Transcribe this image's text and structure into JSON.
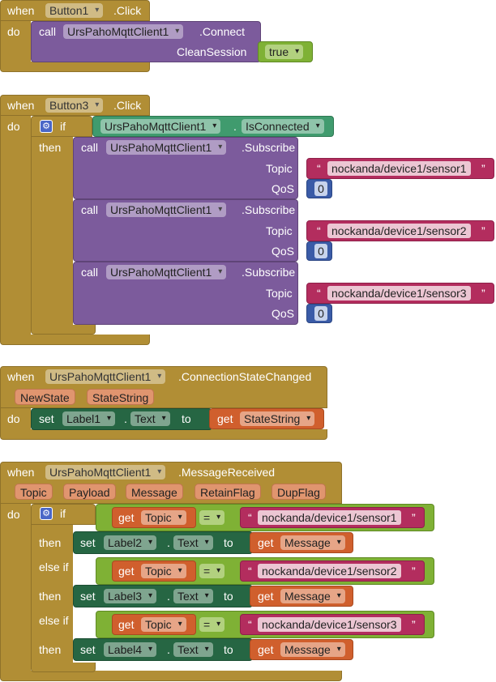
{
  "blocks": {
    "b1": {
      "when": "when",
      "component": "Button1",
      "event": ".Click",
      "do": "do",
      "call": "call",
      "target": "UrsPahoMqttClient1",
      "method": ".Connect",
      "arg_label": "CleanSession",
      "arg_value": "true"
    },
    "b2": {
      "when": "when",
      "component": "Button3",
      "event": ".Click",
      "do": "do",
      "if": "if",
      "then": "then",
      "cond_component": "UrsPahoMqttClient1",
      "cond_property": "IsConnected",
      "calls": [
        {
          "call": "call",
          "target": "UrsPahoMqttClient1",
          "method": ".Subscribe",
          "topic_label": "Topic",
          "topic": "nockanda/device1/sensor1",
          "qos_label": "QoS",
          "qos": "0"
        },
        {
          "call": "call",
          "target": "UrsPahoMqttClient1",
          "method": ".Subscribe",
          "topic_label": "Topic",
          "topic": "nockanda/device1/sensor2",
          "qos_label": "QoS",
          "qos": "0"
        },
        {
          "call": "call",
          "target": "UrsPahoMqttClient1",
          "method": ".Subscribe",
          "topic_label": "Topic",
          "topic": "nockanda/device1/sensor3",
          "qos_label": "QoS",
          "qos": "0"
        }
      ]
    },
    "b3": {
      "when": "when",
      "component": "UrsPahoMqttClient1",
      "event": ".ConnectionStateChanged",
      "params": [
        "NewState",
        "StateString"
      ],
      "do": "do",
      "set": "set",
      "set_component": "Label1",
      "set_property": "Text",
      "to": "to",
      "get": "get",
      "get_var": "StateString"
    },
    "b4": {
      "when": "when",
      "component": "UrsPahoMqttClient1",
      "event": ".MessageReceived",
      "params": [
        "Topic",
        "Payload",
        "Message",
        "RetainFlag",
        "DupFlag"
      ],
      "do": "do",
      "if": "if",
      "else_if": "else if",
      "then": "then",
      "get": "get",
      "eq": "=",
      "set": "set",
      "to": "to",
      "branches": [
        {
          "get_var": "Topic",
          "topic": "nockanda/device1/sensor1",
          "label": "Label2",
          "property": "Text",
          "value_var": "Message"
        },
        {
          "get_var": "Topic",
          "topic": "nockanda/device1/sensor2",
          "label": "Label3",
          "property": "Text",
          "value_var": "Message"
        },
        {
          "get_var": "Topic",
          "topic": "nockanda/device1/sensor3",
          "label": "Label4",
          "property": "Text",
          "value_var": "Message"
        }
      ]
    }
  },
  "glyphs": {
    "quote_open": "“",
    "quote_close": "”",
    "dot": ".",
    "gear_icon": "gear-icon"
  },
  "colors": {
    "event": "#b18e35",
    "call": "#7c5b9c",
    "logic": "#7fb135",
    "text": "#b32d5e",
    "math": "#3a5ba7",
    "property": "#409b6e",
    "setter": "#266643",
    "variable": "#d05f2d"
  }
}
